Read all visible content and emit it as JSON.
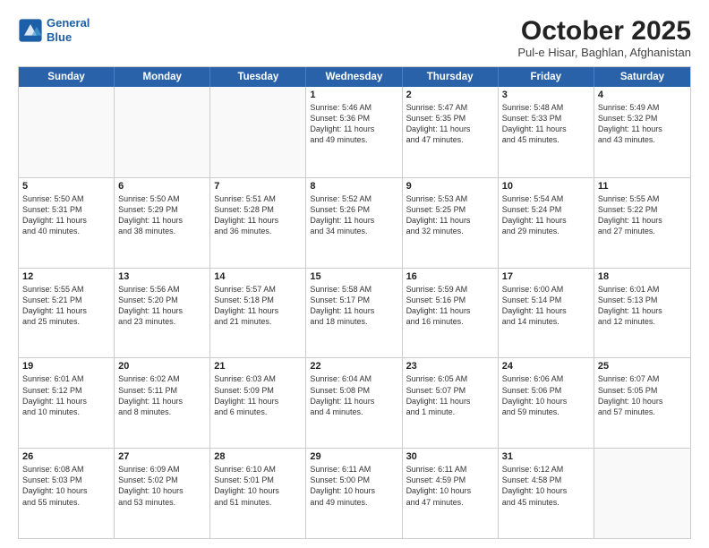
{
  "logo": {
    "line1": "General",
    "line2": "Blue"
  },
  "title": "October 2025",
  "location": "Pul-e Hisar, Baghlan, Afghanistan",
  "header_days": [
    "Sunday",
    "Monday",
    "Tuesday",
    "Wednesday",
    "Thursday",
    "Friday",
    "Saturday"
  ],
  "weeks": [
    [
      {
        "day": "",
        "info": ""
      },
      {
        "day": "",
        "info": ""
      },
      {
        "day": "",
        "info": ""
      },
      {
        "day": "1",
        "info": "Sunrise: 5:46 AM\nSunset: 5:36 PM\nDaylight: 11 hours\nand 49 minutes."
      },
      {
        "day": "2",
        "info": "Sunrise: 5:47 AM\nSunset: 5:35 PM\nDaylight: 11 hours\nand 47 minutes."
      },
      {
        "day": "3",
        "info": "Sunrise: 5:48 AM\nSunset: 5:33 PM\nDaylight: 11 hours\nand 45 minutes."
      },
      {
        "day": "4",
        "info": "Sunrise: 5:49 AM\nSunset: 5:32 PM\nDaylight: 11 hours\nand 43 minutes."
      }
    ],
    [
      {
        "day": "5",
        "info": "Sunrise: 5:50 AM\nSunset: 5:31 PM\nDaylight: 11 hours\nand 40 minutes."
      },
      {
        "day": "6",
        "info": "Sunrise: 5:50 AM\nSunset: 5:29 PM\nDaylight: 11 hours\nand 38 minutes."
      },
      {
        "day": "7",
        "info": "Sunrise: 5:51 AM\nSunset: 5:28 PM\nDaylight: 11 hours\nand 36 minutes."
      },
      {
        "day": "8",
        "info": "Sunrise: 5:52 AM\nSunset: 5:26 PM\nDaylight: 11 hours\nand 34 minutes."
      },
      {
        "day": "9",
        "info": "Sunrise: 5:53 AM\nSunset: 5:25 PM\nDaylight: 11 hours\nand 32 minutes."
      },
      {
        "day": "10",
        "info": "Sunrise: 5:54 AM\nSunset: 5:24 PM\nDaylight: 11 hours\nand 29 minutes."
      },
      {
        "day": "11",
        "info": "Sunrise: 5:55 AM\nSunset: 5:22 PM\nDaylight: 11 hours\nand 27 minutes."
      }
    ],
    [
      {
        "day": "12",
        "info": "Sunrise: 5:55 AM\nSunset: 5:21 PM\nDaylight: 11 hours\nand 25 minutes."
      },
      {
        "day": "13",
        "info": "Sunrise: 5:56 AM\nSunset: 5:20 PM\nDaylight: 11 hours\nand 23 minutes."
      },
      {
        "day": "14",
        "info": "Sunrise: 5:57 AM\nSunset: 5:18 PM\nDaylight: 11 hours\nand 21 minutes."
      },
      {
        "day": "15",
        "info": "Sunrise: 5:58 AM\nSunset: 5:17 PM\nDaylight: 11 hours\nand 18 minutes."
      },
      {
        "day": "16",
        "info": "Sunrise: 5:59 AM\nSunset: 5:16 PM\nDaylight: 11 hours\nand 16 minutes."
      },
      {
        "day": "17",
        "info": "Sunrise: 6:00 AM\nSunset: 5:14 PM\nDaylight: 11 hours\nand 14 minutes."
      },
      {
        "day": "18",
        "info": "Sunrise: 6:01 AM\nSunset: 5:13 PM\nDaylight: 11 hours\nand 12 minutes."
      }
    ],
    [
      {
        "day": "19",
        "info": "Sunrise: 6:01 AM\nSunset: 5:12 PM\nDaylight: 11 hours\nand 10 minutes."
      },
      {
        "day": "20",
        "info": "Sunrise: 6:02 AM\nSunset: 5:11 PM\nDaylight: 11 hours\nand 8 minutes."
      },
      {
        "day": "21",
        "info": "Sunrise: 6:03 AM\nSunset: 5:09 PM\nDaylight: 11 hours\nand 6 minutes."
      },
      {
        "day": "22",
        "info": "Sunrise: 6:04 AM\nSunset: 5:08 PM\nDaylight: 11 hours\nand 4 minutes."
      },
      {
        "day": "23",
        "info": "Sunrise: 6:05 AM\nSunset: 5:07 PM\nDaylight: 11 hours\nand 1 minute."
      },
      {
        "day": "24",
        "info": "Sunrise: 6:06 AM\nSunset: 5:06 PM\nDaylight: 10 hours\nand 59 minutes."
      },
      {
        "day": "25",
        "info": "Sunrise: 6:07 AM\nSunset: 5:05 PM\nDaylight: 10 hours\nand 57 minutes."
      }
    ],
    [
      {
        "day": "26",
        "info": "Sunrise: 6:08 AM\nSunset: 5:03 PM\nDaylight: 10 hours\nand 55 minutes."
      },
      {
        "day": "27",
        "info": "Sunrise: 6:09 AM\nSunset: 5:02 PM\nDaylight: 10 hours\nand 53 minutes."
      },
      {
        "day": "28",
        "info": "Sunrise: 6:10 AM\nSunset: 5:01 PM\nDaylight: 10 hours\nand 51 minutes."
      },
      {
        "day": "29",
        "info": "Sunrise: 6:11 AM\nSunset: 5:00 PM\nDaylight: 10 hours\nand 49 minutes."
      },
      {
        "day": "30",
        "info": "Sunrise: 6:11 AM\nSunset: 4:59 PM\nDaylight: 10 hours\nand 47 minutes."
      },
      {
        "day": "31",
        "info": "Sunrise: 6:12 AM\nSunset: 4:58 PM\nDaylight: 10 hours\nand 45 minutes."
      },
      {
        "day": "",
        "info": ""
      }
    ]
  ]
}
